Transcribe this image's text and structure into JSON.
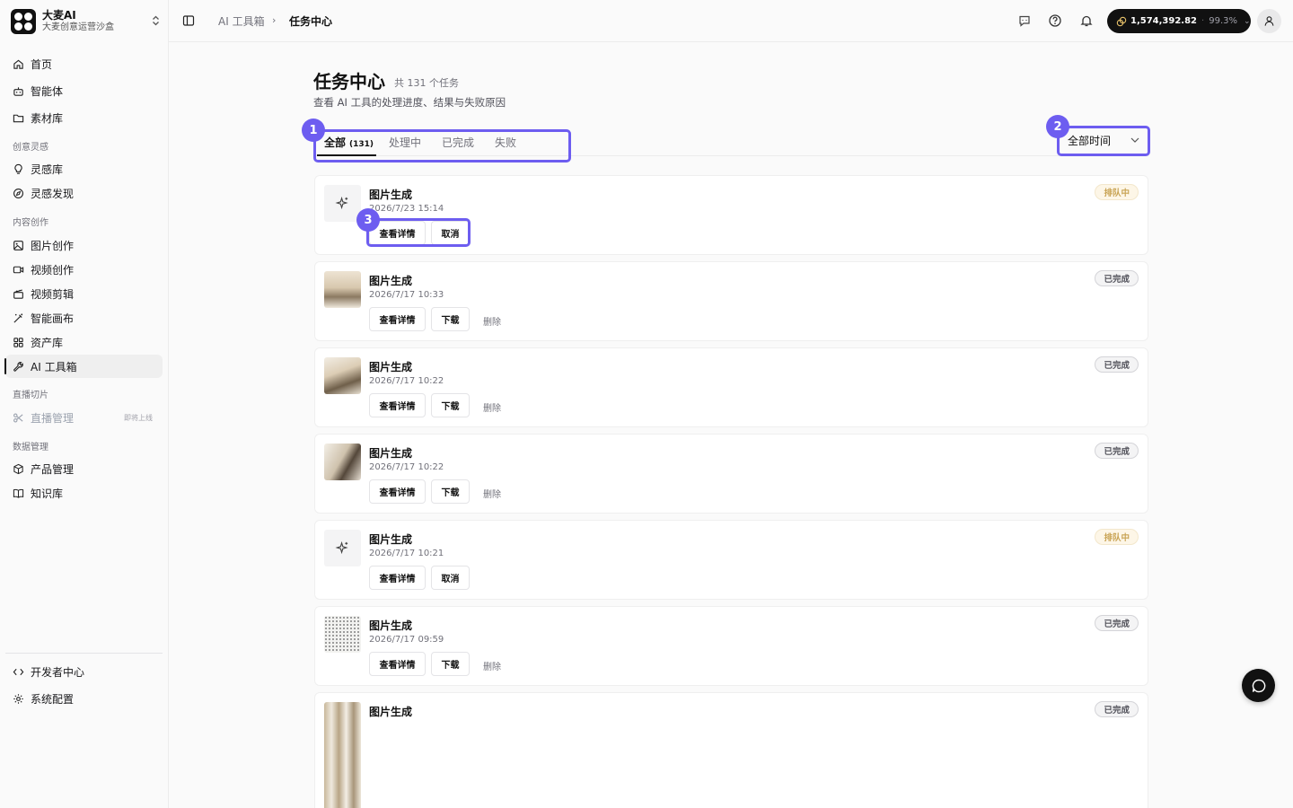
{
  "brand": {
    "name": "大麦AI",
    "subtitle": "大麦创意运营沙盒"
  },
  "sidebar": {
    "home": "首页",
    "agents": "智能体",
    "materials": "素材库",
    "group_inspiration": "创意灵感",
    "inspiration_lib": "灵感库",
    "inspiration_discover": "灵感发现",
    "group_content": "内容创作",
    "image_create": "图片创作",
    "video_create": "视频创作",
    "video_edit": "视频剪辑",
    "smart_canvas": "智能画布",
    "assets": "资产库",
    "ai_toolbox": "AI 工具箱",
    "group_live": "直播切片",
    "live_manage": "直播管理",
    "live_soon": "即将上线",
    "group_data": "数据管理",
    "product_manage": "产品管理",
    "knowledge": "知识库",
    "dev_center": "开发者中心",
    "system_config": "系统配置"
  },
  "topbar": {
    "breadcrumb_parent": "AI 工具箱",
    "breadcrumb_sep": "›",
    "breadcrumb_current": "任务中心",
    "credits_amount": "1,574,392.82",
    "credits_sep": "·",
    "credits_percent": "99.3%",
    "credits_chevron": "⌄"
  },
  "page": {
    "title": "任务中心",
    "count": "共 131 个任务",
    "description": "查看 AI 工具的处理进度、结果与失败原因"
  },
  "tabs": {
    "all": "全部",
    "all_count": "(131)",
    "processing": "处理中",
    "done": "已完成",
    "failed": "失败"
  },
  "filter": {
    "time_value": "全部时间",
    "chevron": "⌄"
  },
  "annotations": {
    "a1": "1",
    "a2": "2",
    "a3": "3"
  },
  "tasks": [
    {
      "title": "图片生成",
      "time": "2026/7/23 15:14",
      "status": "排队中",
      "btn_detail": "查看详情",
      "btn_second": "取消"
    },
    {
      "title": "图片生成",
      "time": "2026/7/17 10:33",
      "status": "已完成",
      "btn_detail": "查看详情",
      "btn_second": "下载",
      "btn_delete": "删除"
    },
    {
      "title": "图片生成",
      "time": "2026/7/17 10:22",
      "status": "已完成",
      "btn_detail": "查看详情",
      "btn_second": "下载",
      "btn_delete": "删除"
    },
    {
      "title": "图片生成",
      "time": "2026/7/17 10:22",
      "status": "已完成",
      "btn_detail": "查看详情",
      "btn_second": "下载",
      "btn_delete": "删除"
    },
    {
      "title": "图片生成",
      "time": "2026/7/17 10:21",
      "status": "排队中",
      "btn_detail": "查看详情",
      "btn_second": "取消"
    },
    {
      "title": "图片生成",
      "time": "2026/7/17 09:59",
      "status": "已完成",
      "btn_detail": "查看详情",
      "btn_second": "下载",
      "btn_delete": "删除"
    },
    {
      "title": "图片生成",
      "status": "已完成"
    }
  ],
  "colors": {
    "accent": "#111111",
    "annotation": "#6d5df0",
    "queue": "#c9a455"
  }
}
